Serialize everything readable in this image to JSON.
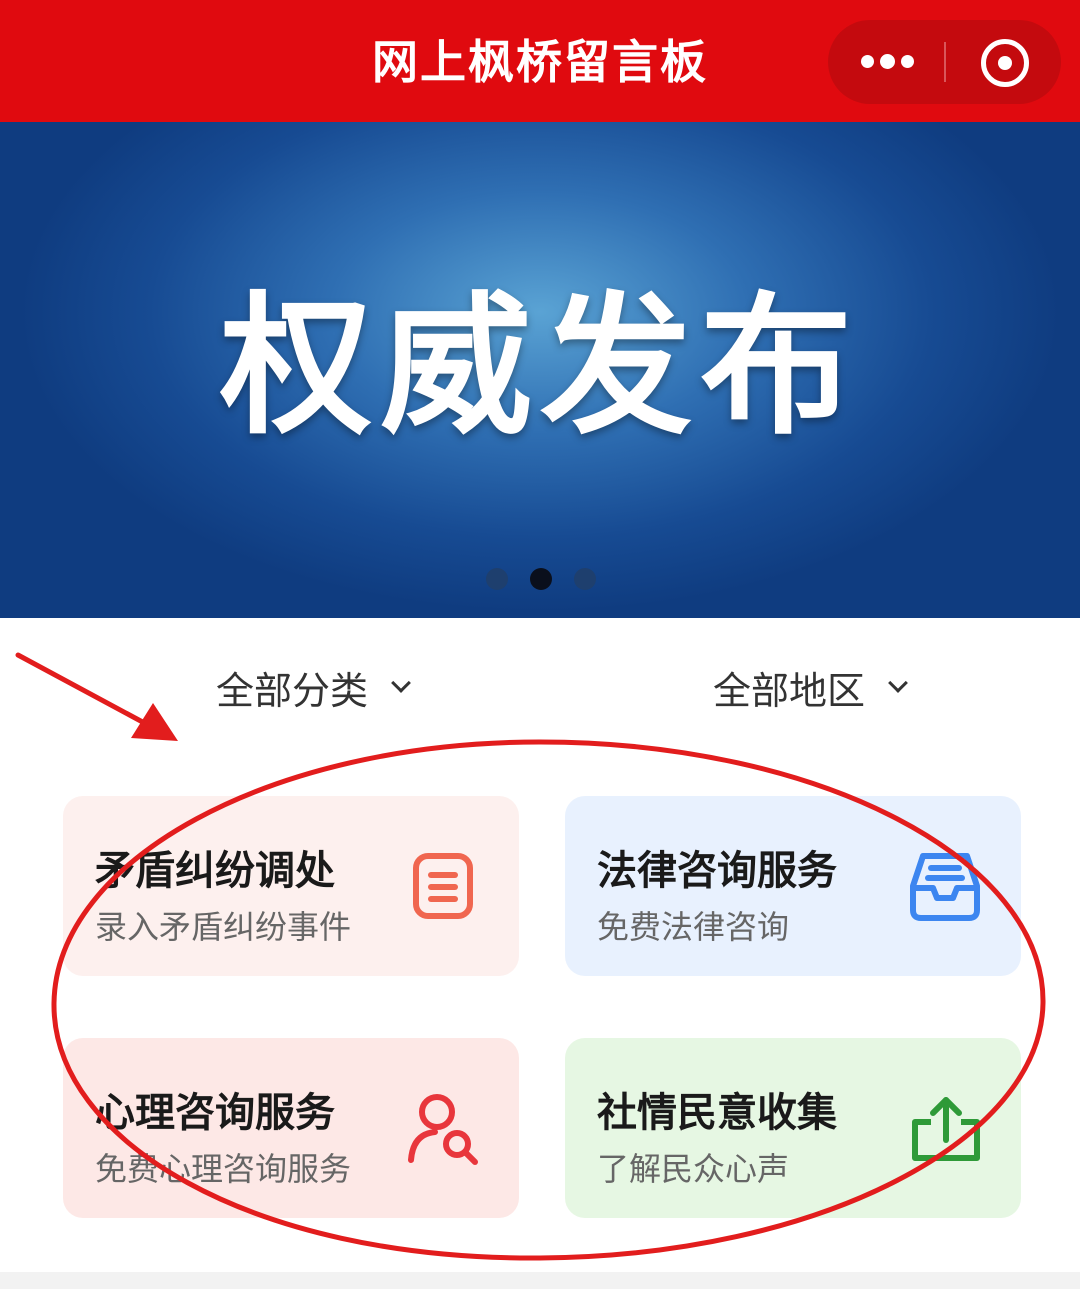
{
  "header": {
    "title": "网上枫桥留言板",
    "background": "#e00a0f",
    "more_icon": "more-dots-icon",
    "close_icon": "target-circle-icon"
  },
  "banner": {
    "title": "权威发布",
    "pager": {
      "count": 3,
      "active_index": 1
    }
  },
  "filters": [
    {
      "label": "全部分类",
      "icon": "chevron-down-icon"
    },
    {
      "label": "全部地区",
      "icon": "chevron-down-icon"
    }
  ],
  "services": [
    {
      "title": "矛盾纠纷调处",
      "subtitle": "录入矛盾纠纷事件",
      "icon": "document-list-icon",
      "bg": "#fdf0ee",
      "icon_color": "#f0664f"
    },
    {
      "title": "法律咨询服务",
      "subtitle": "免费法律咨询",
      "icon": "inbox-tray-icon",
      "bg": "#e8f1fe",
      "icon_color": "#3c86f0"
    },
    {
      "title": "心理咨询服务",
      "subtitle": "免费心理咨询服务",
      "icon": "user-search-icon",
      "bg": "#fde8e6",
      "icon_color": "#e8363c"
    },
    {
      "title": "社情民意收集",
      "subtitle": "了解民众心声",
      "icon": "share-upload-icon",
      "bg": "#e6f7e3",
      "icon_color": "#2e9a38"
    }
  ],
  "annotation": {
    "color": "#e21d1d",
    "shapes": [
      "arrow",
      "ellipse"
    ]
  }
}
